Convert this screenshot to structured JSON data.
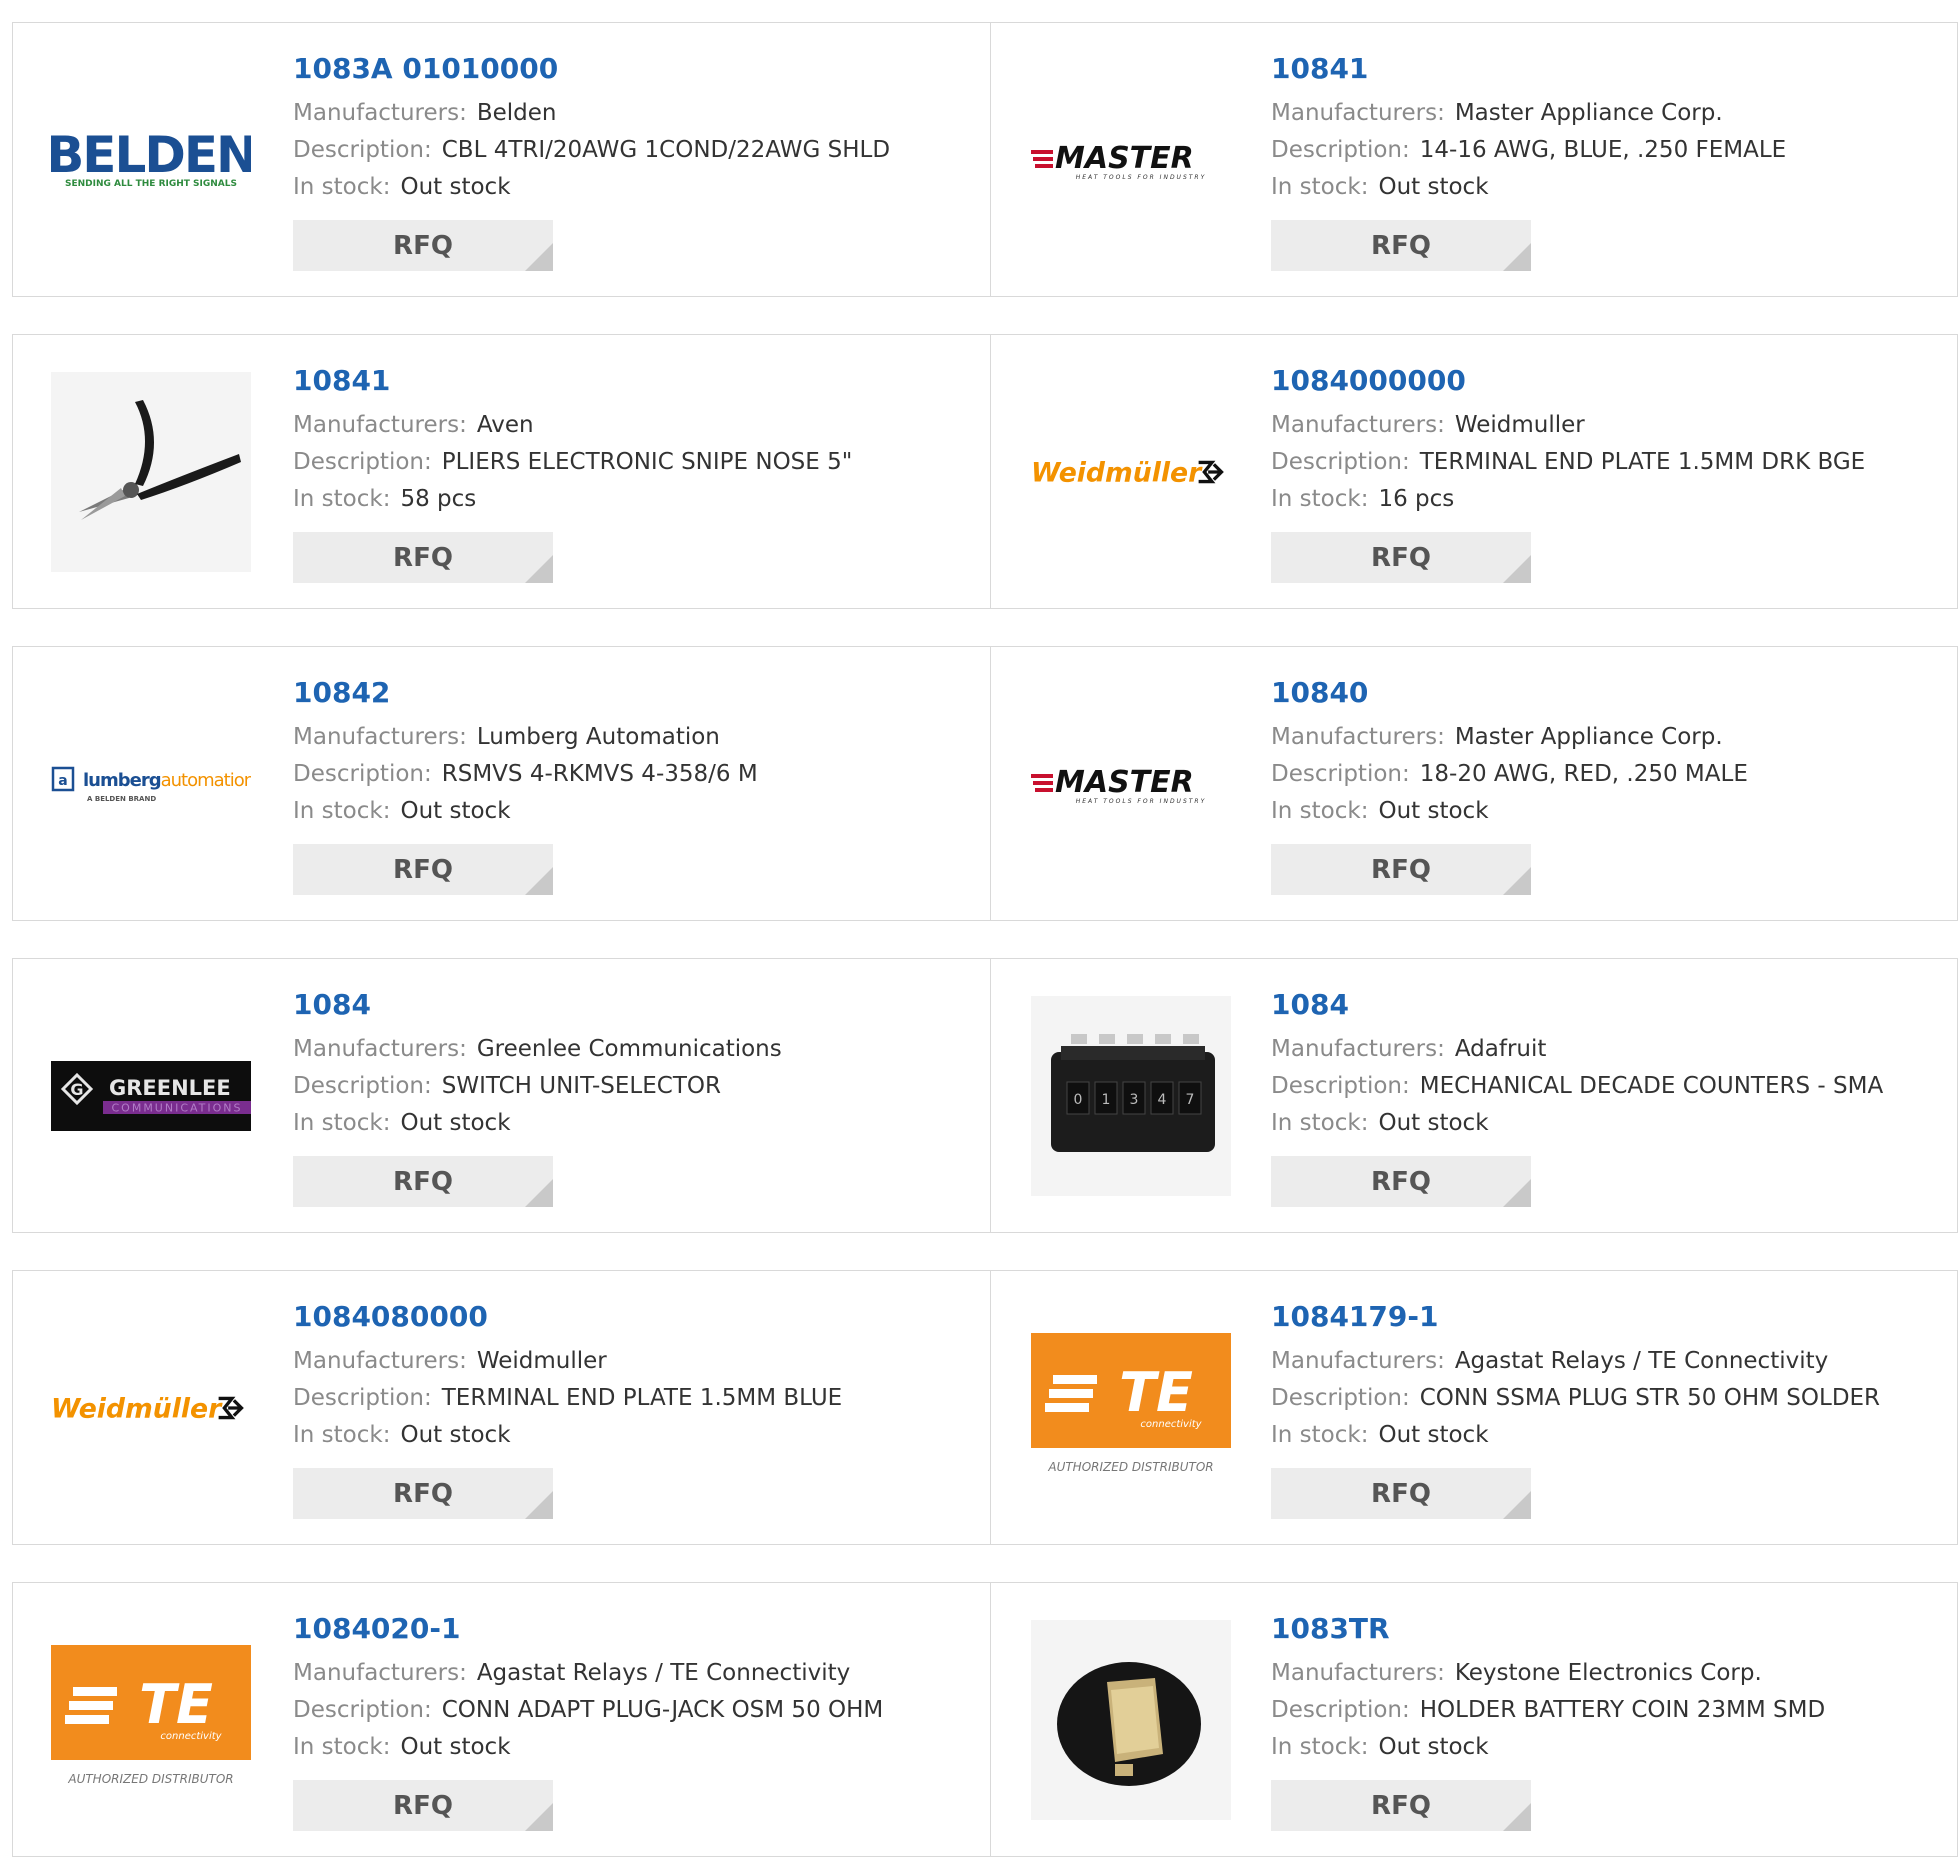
{
  "labels": {
    "manufacturers": "Manufacturers:",
    "description": "Description:",
    "in_stock": "In stock:",
    "rfq": "RFQ"
  },
  "rows": [
    {
      "left": {
        "part": "1083A 01010000",
        "manufacturer": "Belden",
        "description": "CBL 4TRI/20AWG 1COND/22AWG SHLD",
        "stock": "Out stock",
        "logo": {
          "type": "belden-logo",
          "main": "BELDEN",
          "tag": "SENDING ALL THE RIGHT SIGNALS",
          "color": "#1b4f93"
        }
      },
      "right": {
        "part": "10841",
        "manufacturer": "Master Appliance Corp.",
        "description": "14-16 AWG, BLUE, .250 FEMALE",
        "stock": "Out stock",
        "logo": {
          "type": "master-logo",
          "main": "MASTER",
          "tag": "HEAT TOOLS FOR INDUSTRY",
          "color": "#c8102e"
        }
      }
    },
    {
      "left": {
        "part": "10841",
        "manufacturer": "Aven",
        "description": "PLIERS ELECTRONIC SNIPE NOSE 5\"",
        "stock": "58 pcs",
        "logo": {
          "type": "pliers-image"
        }
      },
      "right": {
        "part": "1084000000",
        "manufacturer": "Weidmuller",
        "description": "TERMINAL END PLATE 1.5MM DRK BGE",
        "stock": "16 pcs",
        "logo": {
          "type": "weidmuller-logo",
          "main": "Weidmüller",
          "color": "#f39200"
        }
      }
    },
    {
      "left": {
        "part": "10842",
        "manufacturer": "Lumberg Automation",
        "description": "RSMVS 4-RKMVS 4-358/6 M",
        "stock": "Out stock",
        "logo": {
          "type": "lumberg-logo",
          "main1": "lumberg",
          "main2": "automation",
          "tag": "A BELDEN BRAND",
          "color": "#1b4f93",
          "accent": "#f39200"
        }
      },
      "right": {
        "part": "10840",
        "manufacturer": "Master Appliance Corp.",
        "description": "18-20 AWG, RED, .250 MALE",
        "stock": "Out stock",
        "logo": {
          "type": "master-logo",
          "main": "MASTER",
          "tag": "HEAT TOOLS FOR INDUSTRY",
          "color": "#c8102e"
        }
      }
    },
    {
      "left": {
        "part": "1084",
        "manufacturer": "Greenlee Communications",
        "description": "SWITCH UNIT-SELECTOR",
        "stock": "Out stock",
        "logo": {
          "type": "greenlee-logo",
          "main": "GREENLEE",
          "tag": "COMMUNICATIONS",
          "color": "#7a2d8f"
        }
      },
      "right": {
        "part": "1084",
        "manufacturer": "Adafruit",
        "description": "MECHANICAL DECADE COUNTERS - SMA",
        "stock": "Out stock",
        "logo": {
          "type": "counter-image"
        }
      }
    },
    {
      "left": {
        "part": "1084080000",
        "manufacturer": "Weidmuller",
        "description": "TERMINAL END PLATE 1.5MM BLUE",
        "stock": "Out stock",
        "logo": {
          "type": "weidmuller-logo",
          "main": "Weidmüller",
          "color": "#f39200"
        }
      },
      "right": {
        "part": "1084179-1",
        "manufacturer": "Agastat Relays / TE Connectivity",
        "description": "CONN SSMA PLUG STR 50 OHM SOLDER",
        "stock": "Out stock",
        "logo": {
          "type": "te-logo",
          "main": "TE",
          "sub": "connectivity",
          "tag": "AUTHORIZED DISTRIBUTOR",
          "color": "#f28c1d"
        }
      }
    },
    {
      "left": {
        "part": "1084020-1",
        "manufacturer": "Agastat Relays / TE Connectivity",
        "description": "CONN ADAPT PLUG-JACK OSM 50 OHM",
        "stock": "Out stock",
        "logo": {
          "type": "te-logo",
          "main": "TE",
          "sub": "connectivity",
          "tag": "AUTHORIZED DISTRIBUTOR",
          "color": "#f28c1d"
        }
      },
      "right": {
        "part": "1083TR",
        "manufacturer": "Keystone Electronics Corp.",
        "description": "HOLDER BATTERY COIN 23MM SMD",
        "stock": "Out stock",
        "logo": {
          "type": "battery-holder-image"
        }
      }
    }
  ]
}
